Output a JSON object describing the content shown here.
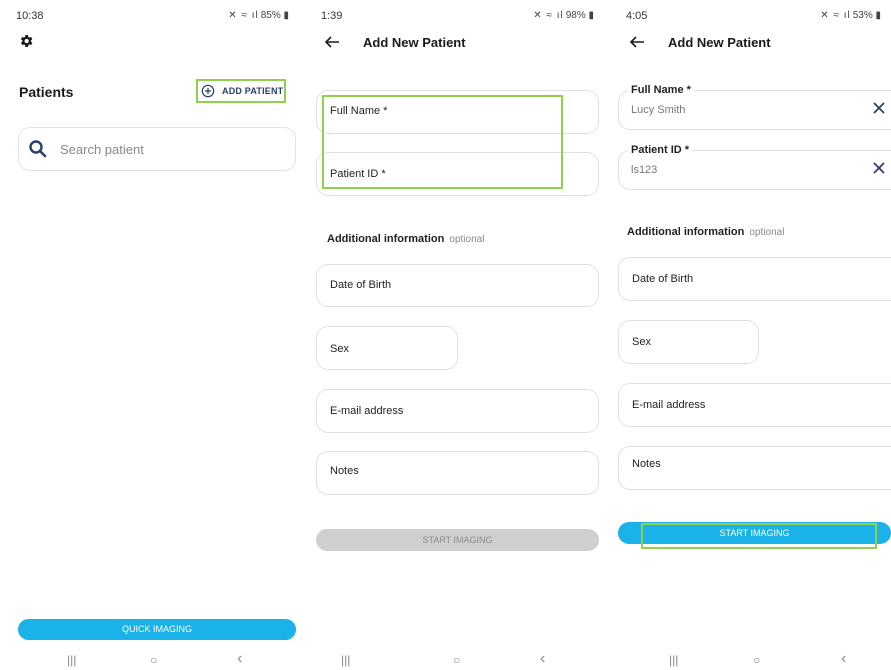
{
  "screens": [
    {
      "status": {
        "time": "10:38",
        "right": "85%"
      },
      "patients_label": "Patients",
      "add_patient_label": "ADD PATIENT",
      "search_placeholder": "Search patient",
      "quick_imaging_label": "QUICK IMAGING"
    },
    {
      "status": {
        "time": "1:39",
        "right": "98%"
      },
      "title": "Add New Patient",
      "fields": {
        "full_name": "Full Name *",
        "patient_id": "Patient ID *",
        "dob": "Date of Birth",
        "sex": "Sex",
        "email": "E-mail address",
        "notes": "Notes"
      },
      "additional_label": "Additional information",
      "optional_label": "optional",
      "start_label": "START IMAGING"
    },
    {
      "status": {
        "time": "4:05",
        "right": "53%"
      },
      "title": "Add New Patient",
      "fields": {
        "full_name": "Full Name *",
        "full_name_value": "Lucy Smith",
        "patient_id": "Patient ID *",
        "patient_id_value": "ls123",
        "dob": "Date of Birth",
        "sex": "Sex",
        "email": "E-mail address",
        "notes": "Notes"
      },
      "additional_label": "Additional information",
      "optional_label": "optional",
      "start_label": "START IMAGING"
    }
  ],
  "navbar": {
    "recent": "|||",
    "home": "○",
    "back": "‹"
  },
  "colors": {
    "accent": "#1ab2e8",
    "highlight": "#8fd14f",
    "navy": "#2a3f6d",
    "disabled": "#cfcfcf"
  },
  "icons": [
    "settings-gear-icon",
    "add-circle-icon",
    "search-icon",
    "back-arrow-icon",
    "clear-icon"
  ]
}
